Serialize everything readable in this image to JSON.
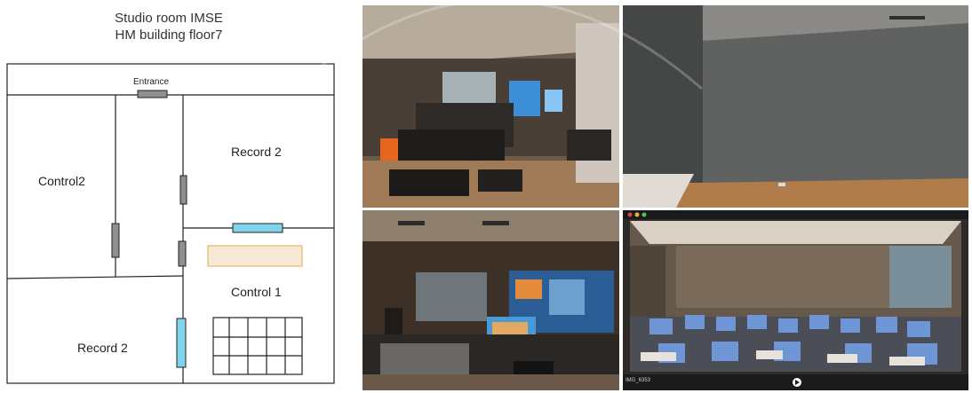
{
  "plan": {
    "title_line1": "Studio room IMSE",
    "title_line2": "HM building floor7",
    "rooms": {
      "entrance": "Entrance",
      "record2_upper": "Record 2",
      "control2": "Control2",
      "control1": "Control 1",
      "record2_lower": "Record 2"
    }
  },
  "photos": [
    {
      "id": "studio-control-room",
      "desc": "mixing console with monitors"
    },
    {
      "id": "empty-recording-room",
      "desc": "gray empty room"
    },
    {
      "id": "control-desk-monitors",
      "desc": "computer desk with large screens"
    },
    {
      "id": "classroom-panorama",
      "desc": "classroom with blue chairs"
    }
  ],
  "viewer_bar": {
    "filename": "IMG_6353"
  },
  "colors": {
    "door_gray": "#8f8f8f",
    "door_blue": "#7fd3ea",
    "table_fill": "#f5e9d6",
    "table_border": "#e3b96a"
  }
}
